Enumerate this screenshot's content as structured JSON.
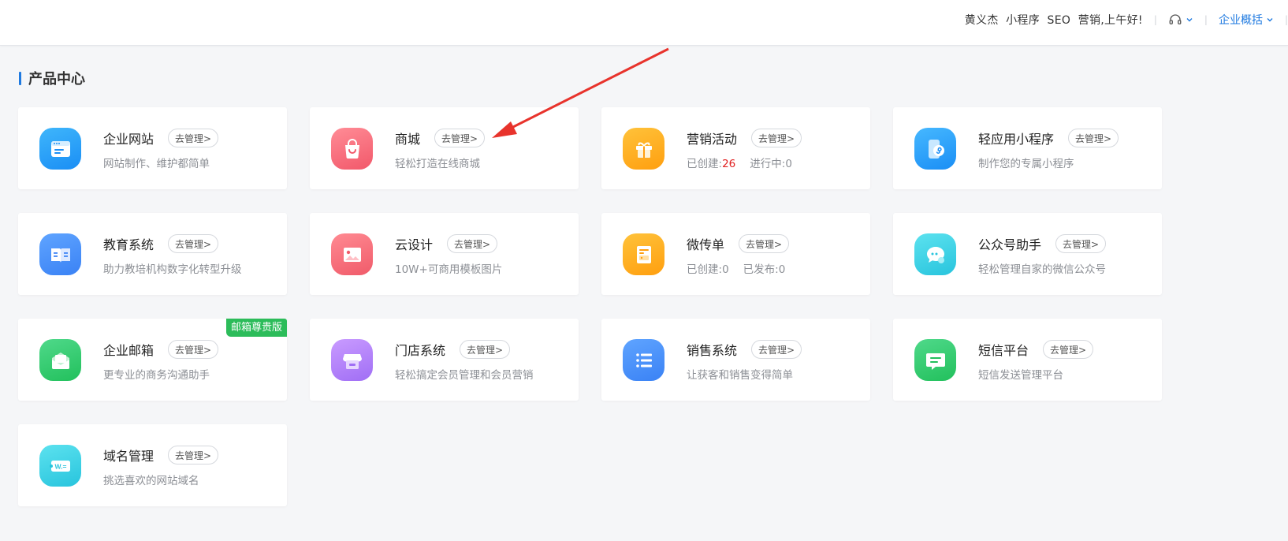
{
  "header": {
    "greeting": "黄义杰  小程序  SEO  营销,上午好!",
    "support_icon": "headset-icon",
    "overview_label": "企业概括"
  },
  "section": {
    "title": "产品中心"
  },
  "manage_label": "去管理>",
  "products": [
    {
      "name": "企业网站",
      "desc": "网站制作、维护都简单",
      "icon": "website-icon",
      "color1": "#3fb6fb",
      "color2": "#1a8ef5"
    },
    {
      "name": "商城",
      "desc": "轻松打造在线商城",
      "icon": "shopping-bag-icon",
      "color1": "#ff8c96",
      "color2": "#f2586a"
    },
    {
      "name": "营销活动",
      "desc": "",
      "icon": "gift-icon",
      "color1": "#ffc23a",
      "color2": "#ff9f0f",
      "stats": {
        "created_label": "已创建:",
        "created_value": "26",
        "second_label": "进行中:",
        "second_value": "0"
      }
    },
    {
      "name": "轻应用小程序",
      "desc": "制作您的专属小程序",
      "icon": "mini-program-icon",
      "color1": "#46b8ff",
      "color2": "#1a8ef5"
    },
    {
      "name": "教育系统",
      "desc": "助力教培机构数字化转型升级",
      "icon": "book-icon",
      "color1": "#5fa4ff",
      "color2": "#3a82f5"
    },
    {
      "name": "云设计",
      "desc": "10W+可商用模板图片",
      "icon": "image-icon",
      "color1": "#ff8a92",
      "color2": "#f05b6a"
    },
    {
      "name": "微传单",
      "desc": "",
      "icon": "flyer-icon",
      "color1": "#ffc23a",
      "color2": "#ff9f0f",
      "stats": {
        "created_label": "已创建:",
        "created_value": "0",
        "second_label": "已发布:",
        "second_value": "0"
      }
    },
    {
      "name": "公众号助手",
      "desc": "轻松管理自家的微信公众号",
      "icon": "wechat-chat-icon",
      "color1": "#5ce2ef",
      "color2": "#28c4dd"
    },
    {
      "name": "企业邮箱",
      "desc": "更专业的商务沟通助手",
      "icon": "mail-icon",
      "color1": "#4fd98a",
      "color2": "#22c05c",
      "badge": "邮箱尊贵版"
    },
    {
      "name": "门店系统",
      "desc": "轻松搞定会员管理和会员营销",
      "icon": "store-icon",
      "color1": "#c99bff",
      "color2": "#a06ef5"
    },
    {
      "name": "销售系统",
      "desc": "让获客和销售变得简单",
      "icon": "list-icon",
      "color1": "#5fa4ff",
      "color2": "#3a82f5"
    },
    {
      "name": "短信平台",
      "desc": "短信发送管理平台",
      "icon": "sms-icon",
      "color1": "#4fd98a",
      "color2": "#22c05c"
    },
    {
      "name": "域名管理",
      "desc": "挑选喜欢的网站域名",
      "icon": "domain-icon",
      "color1": "#5ce2ef",
      "color2": "#28c4dd"
    }
  ],
  "annotation": {
    "arrow_color": "#e8332c"
  }
}
